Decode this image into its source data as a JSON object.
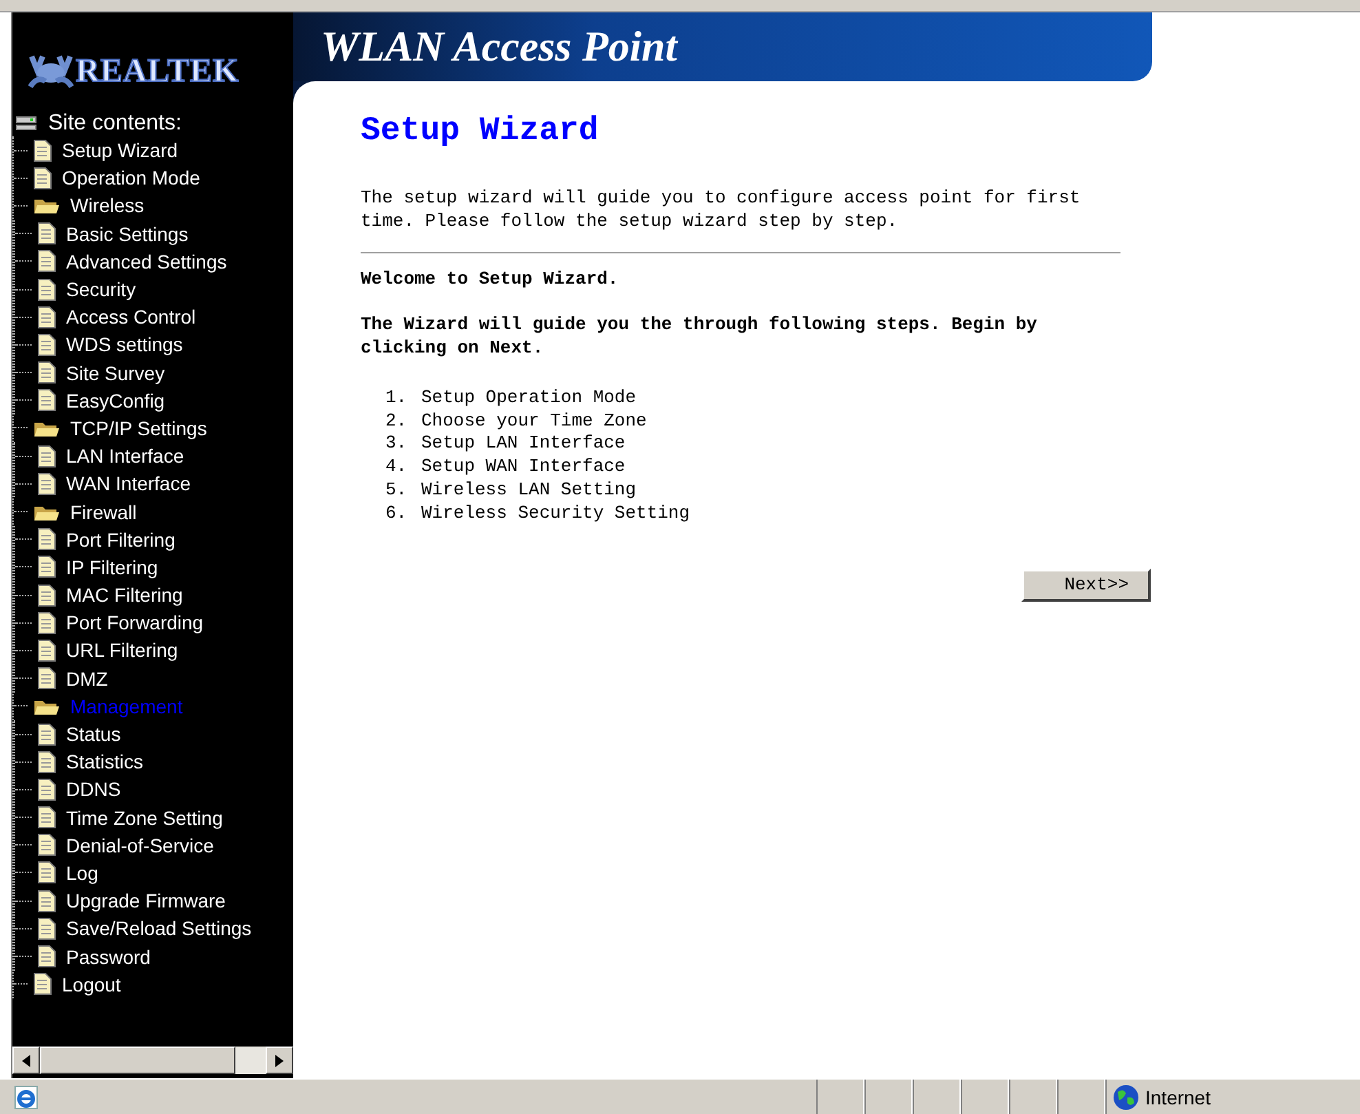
{
  "logo": {
    "text": "REALTEK"
  },
  "banner": {
    "title": "WLAN Access Point"
  },
  "sidebar": {
    "heading": "Site contents:",
    "items": [
      {
        "label": "Setup Wizard",
        "kind": "page",
        "selected": false
      },
      {
        "label": "Operation Mode",
        "kind": "page",
        "selected": false
      },
      {
        "label": "Wireless",
        "kind": "folder",
        "selected": false,
        "children": [
          {
            "label": "Basic Settings",
            "kind": "page",
            "selected": false
          },
          {
            "label": "Advanced Settings",
            "kind": "page",
            "selected": false
          },
          {
            "label": "Security",
            "kind": "page",
            "selected": false
          },
          {
            "label": "Access Control",
            "kind": "page",
            "selected": false
          },
          {
            "label": "WDS settings",
            "kind": "page",
            "selected": false
          },
          {
            "label": "Site Survey",
            "kind": "page",
            "selected": false
          },
          {
            "label": "EasyConfig",
            "kind": "page",
            "selected": false
          }
        ]
      },
      {
        "label": "TCP/IP Settings",
        "kind": "folder",
        "selected": false,
        "children": [
          {
            "label": "LAN Interface",
            "kind": "page",
            "selected": false
          },
          {
            "label": "WAN Interface",
            "kind": "page",
            "selected": false
          }
        ]
      },
      {
        "label": "Firewall",
        "kind": "folder",
        "selected": false,
        "children": [
          {
            "label": "Port Filtering",
            "kind": "page",
            "selected": false
          },
          {
            "label": "IP Filtering",
            "kind": "page",
            "selected": false
          },
          {
            "label": "MAC Filtering",
            "kind": "page",
            "selected": false
          },
          {
            "label": "Port Forwarding",
            "kind": "page",
            "selected": false
          },
          {
            "label": "URL Filtering",
            "kind": "page",
            "selected": false
          },
          {
            "label": "DMZ",
            "kind": "page",
            "selected": false
          }
        ]
      },
      {
        "label": "Management",
        "kind": "folder",
        "selected": true,
        "children": [
          {
            "label": "Status",
            "kind": "page",
            "selected": false
          },
          {
            "label": "Statistics",
            "kind": "page",
            "selected": false
          },
          {
            "label": "DDNS",
            "kind": "page",
            "selected": false
          },
          {
            "label": "Time Zone Setting",
            "kind": "page",
            "selected": false
          },
          {
            "label": "Denial-of-Service",
            "kind": "page",
            "selected": false
          },
          {
            "label": "Log",
            "kind": "page",
            "selected": false
          },
          {
            "label": "Upgrade Firmware",
            "kind": "page",
            "selected": false
          },
          {
            "label": "Save/Reload Settings",
            "kind": "page",
            "selected": false
          },
          {
            "label": "Password",
            "kind": "page",
            "selected": false
          }
        ]
      },
      {
        "label": "Logout",
        "kind": "page",
        "selected": false
      }
    ]
  },
  "content": {
    "title": "Setup Wizard",
    "intro": "The setup wizard will guide you to configure access point for first time. Please follow the setup wizard step by step.",
    "welcome": "Welcome to Setup Wizard.",
    "guide": "The Wizard will guide you the through following steps. Begin by clicking on Next.",
    "steps": [
      {
        "number": "1.",
        "text": "Setup Operation Mode"
      },
      {
        "number": "2.",
        "text": "Choose your Time Zone"
      },
      {
        "number": "3.",
        "text": "Setup LAN Interface"
      },
      {
        "number": "4.",
        "text": "Setup WAN Interface"
      },
      {
        "number": "5.",
        "text": "Wireless LAN Setting"
      },
      {
        "number": "6.",
        "text": "Wireless Security Setting"
      }
    ],
    "next_button": "Next>>"
  },
  "status_bar": {
    "zone": "Internet"
  }
}
